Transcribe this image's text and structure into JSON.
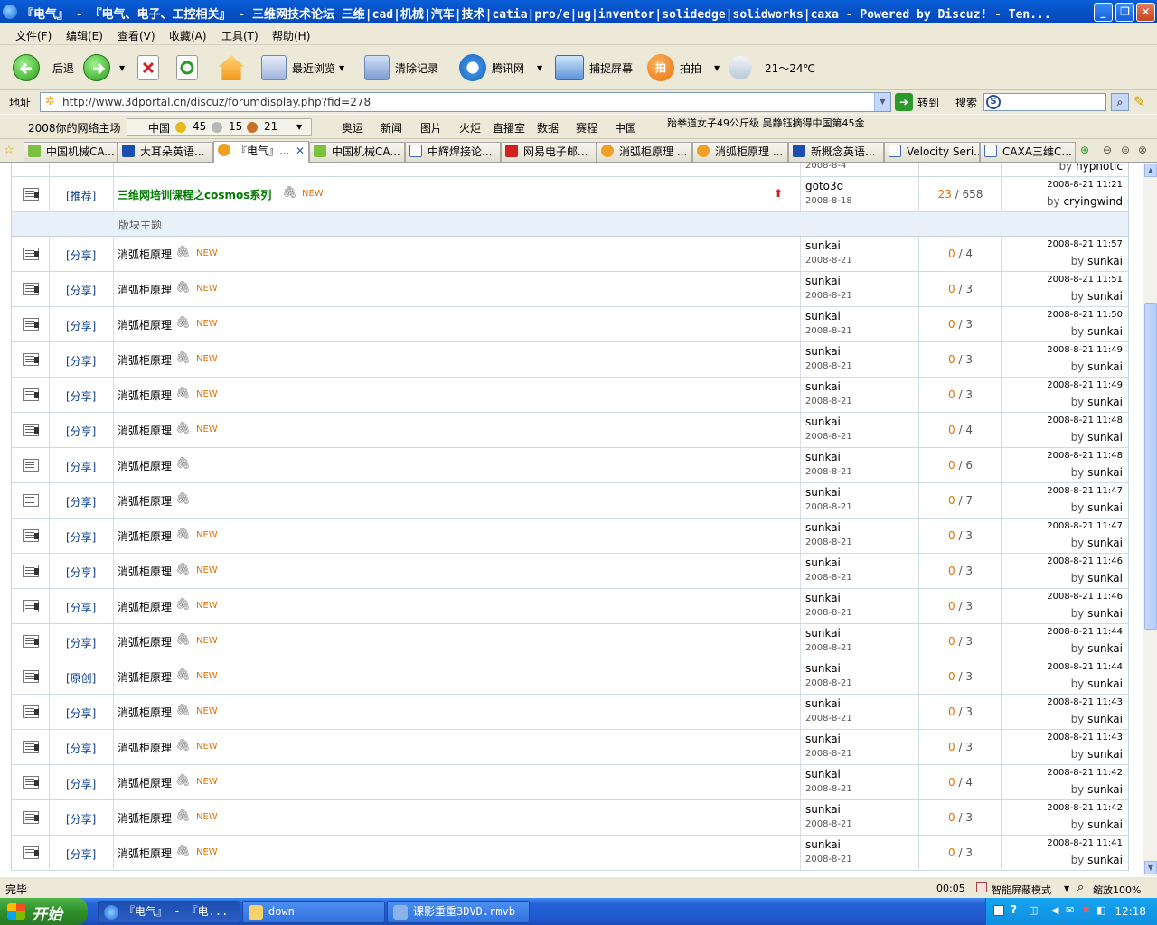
{
  "window": {
    "title": "『电气』 - 『电气、电子、工控相关』 - 三维网技术论坛 三维|cad|机械|汽车|技术|catia|pro/e|ug|inventor|solidedge|solidworks|caxa - Powered by Discuz! - Ten..."
  },
  "menu": [
    "文件(F)",
    "编辑(E)",
    "查看(V)",
    "收藏(A)",
    "工具(T)",
    "帮助(H)"
  ],
  "toolbar": {
    "back": "后退",
    "recent": "最近浏览",
    "clear": "清除记录",
    "tencent": "腾讯网",
    "capture": "捕捉屏幕",
    "paipai": "拍拍",
    "weather": "21～24℃"
  },
  "address": {
    "label": "地址",
    "url": "http://www.3dportal.cn/discuz/forumdisplay.php?fid=278",
    "go": "转到",
    "search": "搜索"
  },
  "links": {
    "items": [
      "2008你的网络主场",
      "中国",
      "45",
      "15",
      "21",
      "奥运",
      "新闻",
      "图片",
      "火炬",
      "直播室",
      "数据",
      "赛程",
      "中国"
    ],
    "ticker": "跆拳道女子49公斤级 吴静钰摘得中国第45金"
  },
  "tabs": [
    "中国机械CA...",
    "大耳朵英语...",
    "『电气』...",
    "中国机械CA...",
    "中辉焊接论...",
    "网易电子邮...",
    "消弧柜原理 ...",
    "消弧柜原理 ...",
    "新概念英语...",
    "Velocity Seri...",
    "CAXA三维C..."
  ],
  "forum": {
    "partial_row": {
      "author_date": "2008-8-4",
      "last_by": "hypnotic"
    },
    "pinned": {
      "type": "[推荐]",
      "subject": "三维网培训课程之cosmos系列",
      "new": "NEW",
      "author": "goto3d",
      "date": "2008-8-18",
      "replies": "23",
      "views": "658",
      "last_time": "2008-8-21 11:21",
      "last_by": "cryingwind"
    },
    "section_label": "版块主题",
    "by": "by",
    "threads": [
      {
        "type": "[分享]",
        "subject": "消弧柜原理",
        "new": "NEW",
        "author": "sunkai",
        "date": "2008-8-21",
        "replies": "0",
        "views": "4",
        "last_time": "2008-8-21 11:57",
        "last_by": "sunkai"
      },
      {
        "type": "[分享]",
        "subject": "消弧柜原理",
        "new": "NEW",
        "author": "sunkai",
        "date": "2008-8-21",
        "replies": "0",
        "views": "3",
        "last_time": "2008-8-21 11:51",
        "last_by": "sunkai"
      },
      {
        "type": "[分享]",
        "subject": "消弧柜原理",
        "new": "NEW",
        "author": "sunkai",
        "date": "2008-8-21",
        "replies": "0",
        "views": "3",
        "last_time": "2008-8-21 11:50",
        "last_by": "sunkai"
      },
      {
        "type": "[分享]",
        "subject": "消弧柜原理",
        "new": "NEW",
        "author": "sunkai",
        "date": "2008-8-21",
        "replies": "0",
        "views": "3",
        "last_time": "2008-8-21 11:49",
        "last_by": "sunkai"
      },
      {
        "type": "[分享]",
        "subject": "消弧柜原理",
        "new": "NEW",
        "author": "sunkai",
        "date": "2008-8-21",
        "replies": "0",
        "views": "3",
        "last_time": "2008-8-21 11:49",
        "last_by": "sunkai"
      },
      {
        "type": "[分享]",
        "subject": "消弧柜原理",
        "new": "NEW",
        "author": "sunkai",
        "date": "2008-8-21",
        "replies": "0",
        "views": "4",
        "last_time": "2008-8-21 11:48",
        "last_by": "sunkai"
      },
      {
        "type": "[分享]",
        "subject": "消弧柜原理",
        "new": "",
        "author": "sunkai",
        "date": "2008-8-21",
        "replies": "0",
        "views": "6",
        "last_time": "2008-8-21 11:48",
        "last_by": "sunkai"
      },
      {
        "type": "[分享]",
        "subject": "消弧柜原理",
        "new": "",
        "author": "sunkai",
        "date": "2008-8-21",
        "replies": "0",
        "views": "7",
        "last_time": "2008-8-21 11:47",
        "last_by": "sunkai"
      },
      {
        "type": "[分享]",
        "subject": "消弧柜原理",
        "new": "NEW",
        "author": "sunkai",
        "date": "2008-8-21",
        "replies": "0",
        "views": "3",
        "last_time": "2008-8-21 11:47",
        "last_by": "sunkai"
      },
      {
        "type": "[分享]",
        "subject": "消弧柜原理",
        "new": "NEW",
        "author": "sunkai",
        "date": "2008-8-21",
        "replies": "0",
        "views": "3",
        "last_time": "2008-8-21 11:46",
        "last_by": "sunkai"
      },
      {
        "type": "[分享]",
        "subject": "消弧柜原理",
        "new": "NEW",
        "author": "sunkai",
        "date": "2008-8-21",
        "replies": "0",
        "views": "3",
        "last_time": "2008-8-21 11:46",
        "last_by": "sunkai"
      },
      {
        "type": "[分享]",
        "subject": "消弧柜原理",
        "new": "NEW",
        "author": "sunkai",
        "date": "2008-8-21",
        "replies": "0",
        "views": "3",
        "last_time": "2008-8-21 11:44",
        "last_by": "sunkai"
      },
      {
        "type": "[原创]",
        "subject": "消弧柜原理",
        "new": "NEW",
        "author": "sunkai",
        "date": "2008-8-21",
        "replies": "0",
        "views": "3",
        "last_time": "2008-8-21 11:44",
        "last_by": "sunkai"
      },
      {
        "type": "[分享]",
        "subject": "消弧柜原理",
        "new": "NEW",
        "author": "sunkai",
        "date": "2008-8-21",
        "replies": "0",
        "views": "3",
        "last_time": "2008-8-21 11:43",
        "last_by": "sunkai"
      },
      {
        "type": "[分享]",
        "subject": "消弧柜原理",
        "new": "NEW",
        "author": "sunkai",
        "date": "2008-8-21",
        "replies": "0",
        "views": "3",
        "last_time": "2008-8-21 11:43",
        "last_by": "sunkai"
      },
      {
        "type": "[分享]",
        "subject": "消弧柜原理",
        "new": "NEW",
        "author": "sunkai",
        "date": "2008-8-21",
        "replies": "0",
        "views": "4",
        "last_time": "2008-8-21 11:42",
        "last_by": "sunkai"
      },
      {
        "type": "[分享]",
        "subject": "消弧柜原理",
        "new": "NEW",
        "author": "sunkai",
        "date": "2008-8-21",
        "replies": "0",
        "views": "3",
        "last_time": "2008-8-21 11:42",
        "last_by": "sunkai"
      },
      {
        "type": "[分享]",
        "subject": "消弧柜原理",
        "new": "NEW",
        "author": "sunkai",
        "date": "2008-8-21",
        "replies": "0",
        "views": "3",
        "last_time": "2008-8-21 11:41",
        "last_by": "sunkai"
      }
    ]
  },
  "status": {
    "text": "完毕",
    "time": "00:05",
    "mode": "智能屏蔽模式",
    "zoom": "缩放100%"
  },
  "taskbar": {
    "start": "开始",
    "tasks": [
      "『电气』 - 『电...",
      "down",
      "课影重重3DVD.rmvb"
    ],
    "clock": "12:18"
  }
}
